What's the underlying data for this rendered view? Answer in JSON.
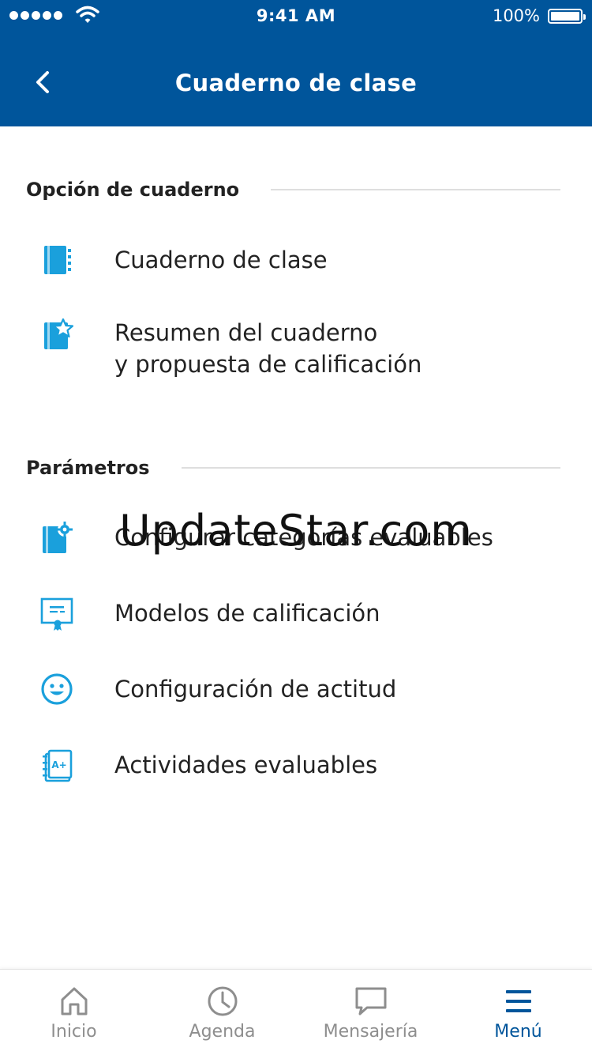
{
  "status_bar": {
    "time": "9:41 AM",
    "battery": "100%"
  },
  "header": {
    "title": "Cuaderno de clase"
  },
  "sections": [
    {
      "title": "Opción de cuaderno",
      "items": [
        {
          "label": "Cuaderno de clase",
          "icon": "notebook-icon"
        },
        {
          "label_line1": "Resumen del cuaderno",
          "label_line2": "y propuesta de calificación",
          "icon": "notebook-star-icon"
        }
      ]
    },
    {
      "title": "Parámetros",
      "items": [
        {
          "label": "Configurar categorías evaluables",
          "icon": "notebook-gear-icon"
        },
        {
          "label": "Modelos de calificación",
          "icon": "certificate-icon"
        },
        {
          "label": "Configuración de actitud",
          "icon": "smiley-icon"
        },
        {
          "label": "Actividades evaluables",
          "icon": "grade-notebook-icon"
        }
      ]
    }
  ],
  "watermark": "UpdateStar.com",
  "tabbar": {
    "tabs": [
      {
        "label": "Inicio",
        "icon": "home-icon",
        "active": false
      },
      {
        "label": "Agenda",
        "icon": "clock-icon",
        "active": false
      },
      {
        "label": "Mensajería",
        "icon": "chat-icon",
        "active": false
      },
      {
        "label": "Menú",
        "icon": "menu-icon",
        "active": true
      }
    ]
  },
  "colors": {
    "header_bg": "#00559b",
    "icon_blue": "#1aa0dc",
    "inactive_tab": "#8e8e8e",
    "active_tab": "#00559b"
  }
}
